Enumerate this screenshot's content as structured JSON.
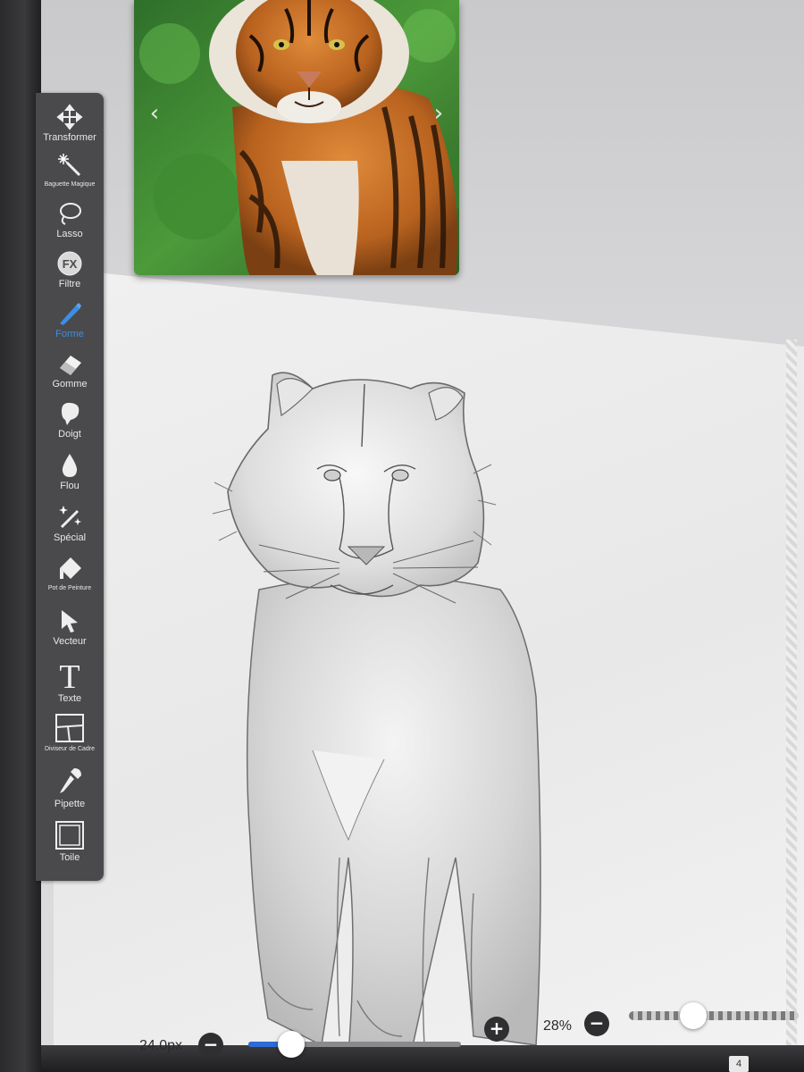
{
  "reference_panel": {
    "prev_glyph": "‹",
    "next_glyph": "›"
  },
  "toolbar": {
    "tools": [
      {
        "label": "Transformer",
        "icon": "move-arrows-icon",
        "active": false
      },
      {
        "label": "Baguette Magique",
        "icon": "magic-wand-icon",
        "active": false
      },
      {
        "label": "Lasso",
        "icon": "lasso-icon",
        "active": false
      },
      {
        "label": "Filtre",
        "icon": "fx-icon",
        "icon_text": "FX",
        "active": false
      },
      {
        "label": "Forme",
        "icon": "brush-icon",
        "active": true
      },
      {
        "label": "Gomme",
        "icon": "eraser-icon",
        "active": false
      },
      {
        "label": "Doigt",
        "icon": "smudge-finger-icon",
        "active": false
      },
      {
        "label": "Flou",
        "icon": "blur-drop-icon",
        "active": false
      },
      {
        "label": "Spécial",
        "icon": "special-wand-icon",
        "active": false
      },
      {
        "label": "Pot de Peinture",
        "icon": "paint-bucket-icon",
        "active": false
      },
      {
        "label": "Vecteur",
        "icon": "vector-cursor-icon",
        "active": false
      },
      {
        "label": "Texte",
        "icon": "text-t-icon",
        "icon_text": "T",
        "active": false
      },
      {
        "label": "Diviseur de Cadre",
        "icon": "frame-divider-icon",
        "active": false
      },
      {
        "label": "Pipette",
        "icon": "eyedropper-icon",
        "active": false
      },
      {
        "label": "Toile",
        "icon": "canvas-icon",
        "active": false
      }
    ]
  },
  "brush_size": {
    "label": "24.0px",
    "minus": "−",
    "plus": "+",
    "slider_fraction": 0.2
  },
  "zoom": {
    "label": "28%",
    "minus": "−",
    "slider_fraction": 0.38
  },
  "layers": {
    "count": "4"
  },
  "colors": {
    "toolbar_bg": "#4a4a4c",
    "accent": "#3a8ee6",
    "slider_fill": "#2e6bd6"
  }
}
